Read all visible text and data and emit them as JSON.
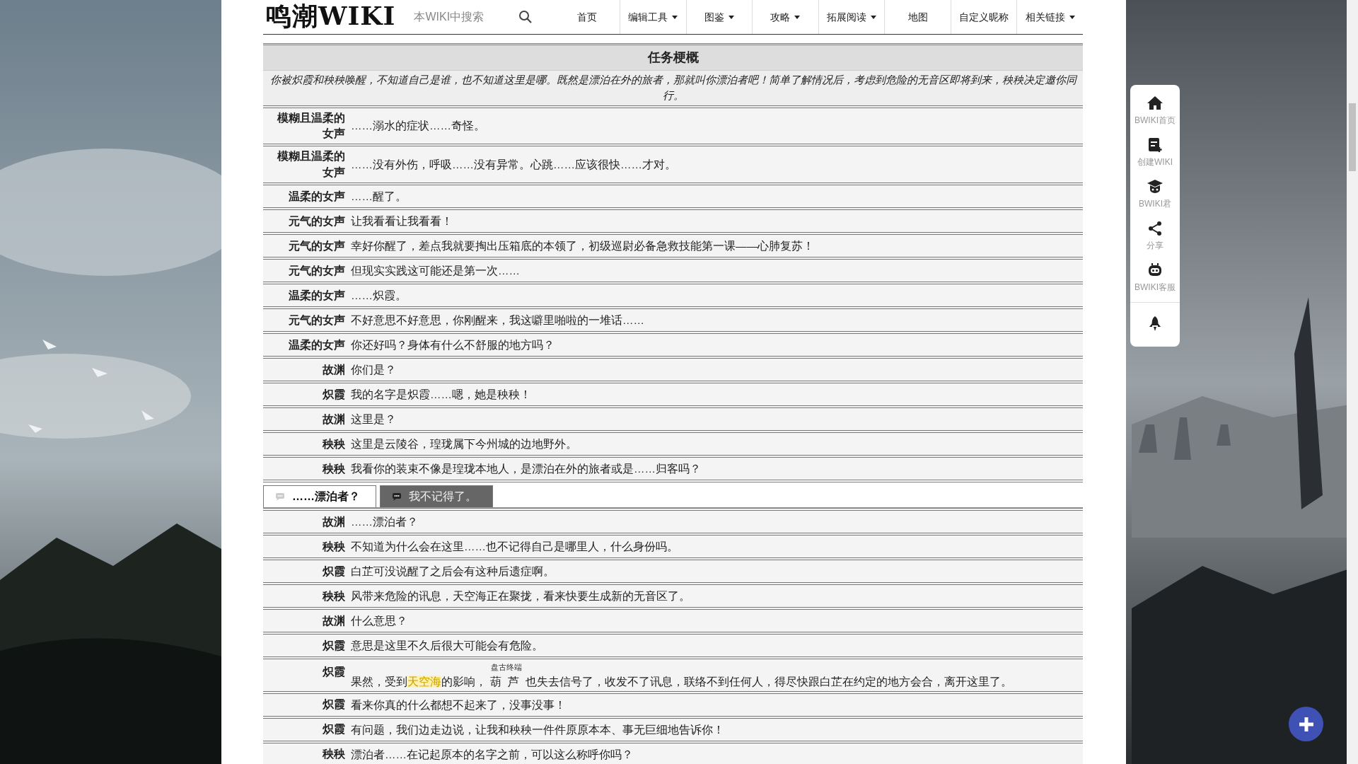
{
  "header": {
    "logo": "鸣潮WIKI",
    "search": {
      "placeholder": "本WIKI中搜索"
    },
    "nav": [
      {
        "label": "首页",
        "dropdown": false
      },
      {
        "label": "编辑工具",
        "dropdown": true
      },
      {
        "label": "图鉴",
        "dropdown": true
      },
      {
        "label": "攻略",
        "dropdown": true
      },
      {
        "label": "拓展阅读",
        "dropdown": true
      },
      {
        "label": "地图",
        "dropdown": false
      },
      {
        "label": "自定义昵称",
        "dropdown": false
      },
      {
        "label": "相关链接",
        "dropdown": true
      }
    ]
  },
  "summary": {
    "title": "任务梗概",
    "text": "你被炽霞和秧秧唤醒，不知道自己是谁，也不知道这里是哪。既然是漂泊在外的旅者，那就叫你漂泊者吧！简单了解情况后，考虑到危险的无音区即将到来，秧秧决定邀你同行。"
  },
  "dialogue": [
    {
      "kind": "line",
      "speaker": "模糊且温柔的女声",
      "text": "……溺水的症状……奇怪。"
    },
    {
      "kind": "line",
      "speaker": "模糊且温柔的女声",
      "text": "……没有外伤，呼吸……没有异常。心跳……应该很快……才对。"
    },
    {
      "kind": "line",
      "speaker": "温柔的女声",
      "text": "……醒了。"
    },
    {
      "kind": "line",
      "speaker": "元气的女声",
      "text": "让我看看让我看看！"
    },
    {
      "kind": "line",
      "speaker": "元气的女声",
      "text": "幸好你醒了，差点我就要掏出压箱底的本领了，初级巡尉必备急救技能第一课——心肺复苏！"
    },
    {
      "kind": "line",
      "speaker": "元气的女声",
      "text": "但现实实践这可能还是第一次……"
    },
    {
      "kind": "line",
      "speaker": "温柔的女声",
      "text": "……炽霞。"
    },
    {
      "kind": "line",
      "speaker": "元气的女声",
      "text": "不好意思不好意思，你刚醒来，我这噼里啪啦的一堆话……"
    },
    {
      "kind": "line",
      "speaker": "温柔的女声",
      "text": "你还好吗？身体有什么不舒服的地方吗？"
    },
    {
      "kind": "line",
      "speaker": "故渊",
      "text": "你们是？"
    },
    {
      "kind": "line",
      "speaker": "炽霞",
      "text": "我的名字是炽霞……嗯，她是秧秧！"
    },
    {
      "kind": "line",
      "speaker": "故渊",
      "text": "这里是？"
    },
    {
      "kind": "line",
      "speaker": "秧秧",
      "text": "这里是云陵谷，瑝珑属下今州城的边地野外。"
    },
    {
      "kind": "line",
      "speaker": "秧秧",
      "text": "我看你的装束不像是瑝珑本地人，是漂泊在外的旅者或是……归客吗？"
    },
    {
      "kind": "choice",
      "options": [
        {
          "label": "……漂泊者？",
          "selected": true
        },
        {
          "label": "我不记得了。",
          "selected": false
        }
      ]
    },
    {
      "kind": "line",
      "speaker": "故渊",
      "text": "……漂泊者？"
    },
    {
      "kind": "line",
      "speaker": "秧秧",
      "text": "不知道为什么会在这里……也不记得自己是哪里人，什么身份吗。"
    },
    {
      "kind": "line",
      "speaker": "炽霞",
      "text": "白芷可没说醒了之后会有这种后遗症啊。"
    },
    {
      "kind": "line",
      "speaker": "秧秧",
      "text": "风带来危险的讯息，天空海正在聚拢，看来快要生成新的无音区了。"
    },
    {
      "kind": "line",
      "speaker": "故渊",
      "text": "什么意思？"
    },
    {
      "kind": "line",
      "speaker": "炽霞",
      "text": "意思是这里不久后很大可能会有危险。"
    },
    {
      "kind": "rich",
      "speaker": "炽霞",
      "segments": [
        {
          "kind": "plain",
          "text": "果然，受到"
        },
        {
          "kind": "term",
          "text": "天空海"
        },
        {
          "kind": "plain",
          "text": "的影响，"
        },
        {
          "kind": "ruby",
          "text": "葫芦",
          "ruby": "盘古终端"
        },
        {
          "kind": "plain",
          "text": "也失去信号了，收发不了讯息，联络不到任何人，得尽快跟白芷在约定的地方会合，离开这里了。"
        }
      ]
    },
    {
      "kind": "line",
      "speaker": "炽霞",
      "text": "看来你真的什么都想不起来了，没事没事！"
    },
    {
      "kind": "line",
      "speaker": "炽霞",
      "text": "有问题，我们边走边说，让我和秧秧一件件原原本本、事无巨细地告诉你！"
    },
    {
      "kind": "line",
      "speaker": "秧秧",
      "text": "漂泊者……在记起原本的名字之前，可以这么称呼你吗？"
    }
  ],
  "sidebar": [
    {
      "kind": "home",
      "label": "BWIKI首页"
    },
    {
      "kind": "create",
      "label": "创建WIKI"
    },
    {
      "kind": "mascot",
      "label": "BWIKI君"
    },
    {
      "kind": "share",
      "label": "分享"
    },
    {
      "kind": "service",
      "label": "BWIKI客服"
    },
    {
      "kind": "top"
    }
  ]
}
